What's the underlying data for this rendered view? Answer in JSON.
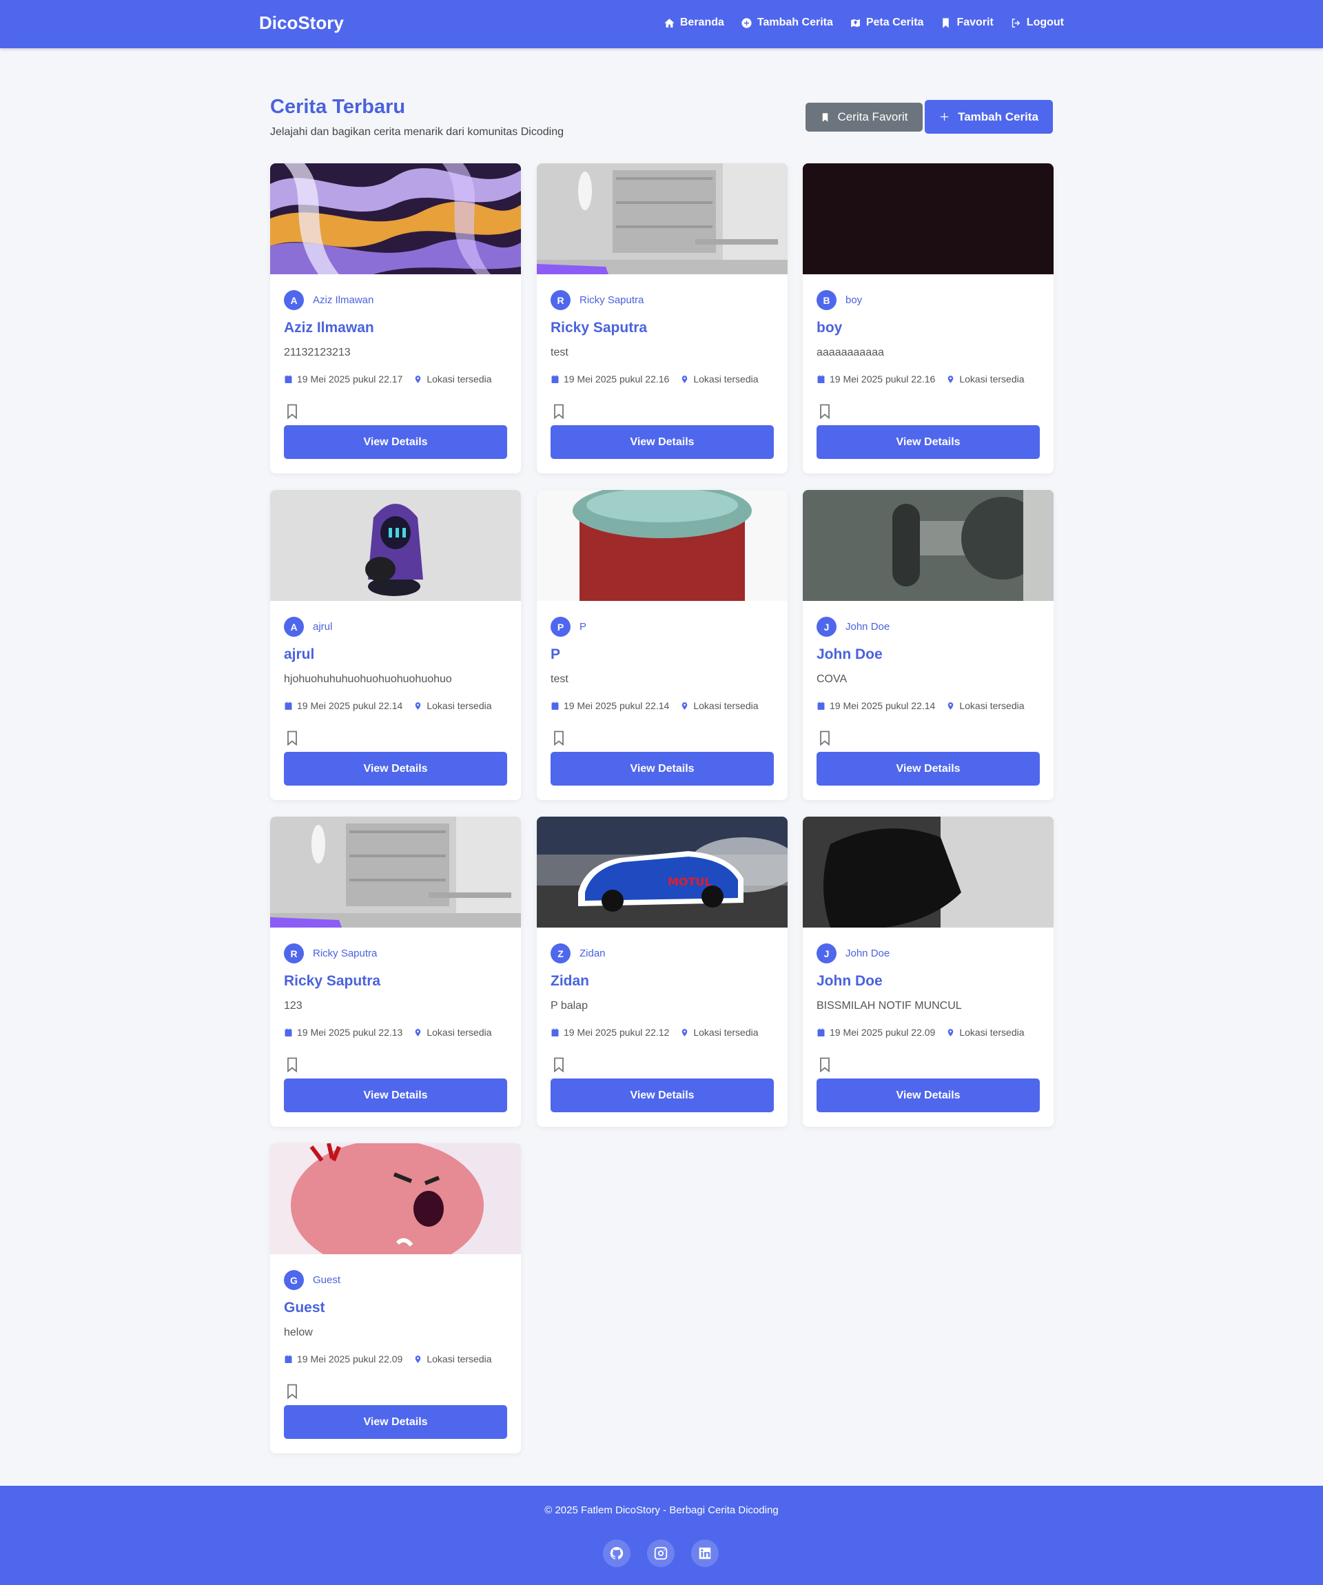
{
  "nav": {
    "brand": "DicoStory",
    "links": [
      {
        "label": "Beranda",
        "icon": "home-icon"
      },
      {
        "label": "Tambah Cerita",
        "icon": "plus-circle-icon"
      },
      {
        "label": "Peta Cerita",
        "icon": "map-icon"
      },
      {
        "label": "Favorit",
        "icon": "bookmark-icon"
      },
      {
        "label": "Logout",
        "icon": "logout-icon"
      }
    ]
  },
  "header": {
    "title": "Cerita Terbaru",
    "subtitle": "Jelajahi dan bagikan cerita menarik dari komunitas Dicoding",
    "fav_button": "Cerita Favorit",
    "add_button": "Tambah Cerita"
  },
  "stories": [
    {
      "initial": "A",
      "author": "Aziz Ilmawan",
      "title": "Aziz Ilmawan",
      "description": "21132123213",
      "date": "19 Mei 2025 pukul 22.17",
      "location": "Lokasi tersedia",
      "button": "View Details",
      "image": "abstract-swirl"
    },
    {
      "initial": "R",
      "author": "Ricky Saputra",
      "title": "Ricky Saputra",
      "description": "test",
      "date": "19 Mei 2025 pukul 22.16",
      "location": "Lokasi tersedia",
      "button": "View Details",
      "image": "office-room"
    },
    {
      "initial": "B",
      "author": "boy",
      "title": "boy",
      "description": "aaaaaaaaaaa",
      "date": "19 Mei 2025 pukul 22.16",
      "location": "Lokasi tersedia",
      "button": "View Details",
      "image": "dark"
    },
    {
      "initial": "A",
      "author": "ajrul",
      "title": "ajrul",
      "description": "hjohuohuhuhuohuohuohuohuohuo",
      "date": "19 Mei 2025 pukul 22.14",
      "location": "Lokasi tersedia",
      "button": "View Details",
      "image": "hooded-character"
    },
    {
      "initial": "P",
      "author": "P",
      "title": "P",
      "description": "test",
      "date": "19 Mei 2025 pukul 22.14",
      "location": "Lokasi tersedia",
      "button": "View Details",
      "image": "red-figure"
    },
    {
      "initial": "J",
      "author": "John Doe",
      "title": "John Doe",
      "description": "COVA",
      "date": "19 Mei 2025 pukul 22.14",
      "location": "Lokasi tersedia",
      "button": "View Details",
      "image": "device-closeup"
    },
    {
      "initial": "R",
      "author": "Ricky Saputra",
      "title": "Ricky Saputra",
      "description": "123",
      "date": "19 Mei 2025 pukul 22.13",
      "location": "Lokasi tersedia",
      "button": "View Details",
      "image": "office-room"
    },
    {
      "initial": "Z",
      "author": "Zidan",
      "title": "Zidan",
      "description": "P balap",
      "date": "19 Mei 2025 pukul 22.12",
      "location": "Lokasi tersedia",
      "button": "View Details",
      "image": "rally-car"
    },
    {
      "initial": "J",
      "author": "John Doe",
      "title": "John Doe",
      "description": "BISSMILAH NOTIF MUNCUL",
      "date": "19 Mei 2025 pukul 22.09",
      "location": "Lokasi tersedia",
      "button": "View Details",
      "image": "dark-fabric"
    },
    {
      "initial": "G",
      "author": "Guest",
      "title": "Guest",
      "description": "helow",
      "date": "19 Mei 2025 pukul 22.09",
      "location": "Lokasi tersedia",
      "button": "View Details",
      "image": "angry-pink-character"
    }
  ],
  "footer": {
    "copyright": "© 2025 Fatlem DicoStory - Berbagi Cerita Dicoding",
    "socials": [
      "github-icon",
      "instagram-icon",
      "linkedin-icon"
    ]
  },
  "colors": {
    "primary": "#4f67ec",
    "secondary": "#6c757d",
    "background": "#f5f6fa"
  }
}
